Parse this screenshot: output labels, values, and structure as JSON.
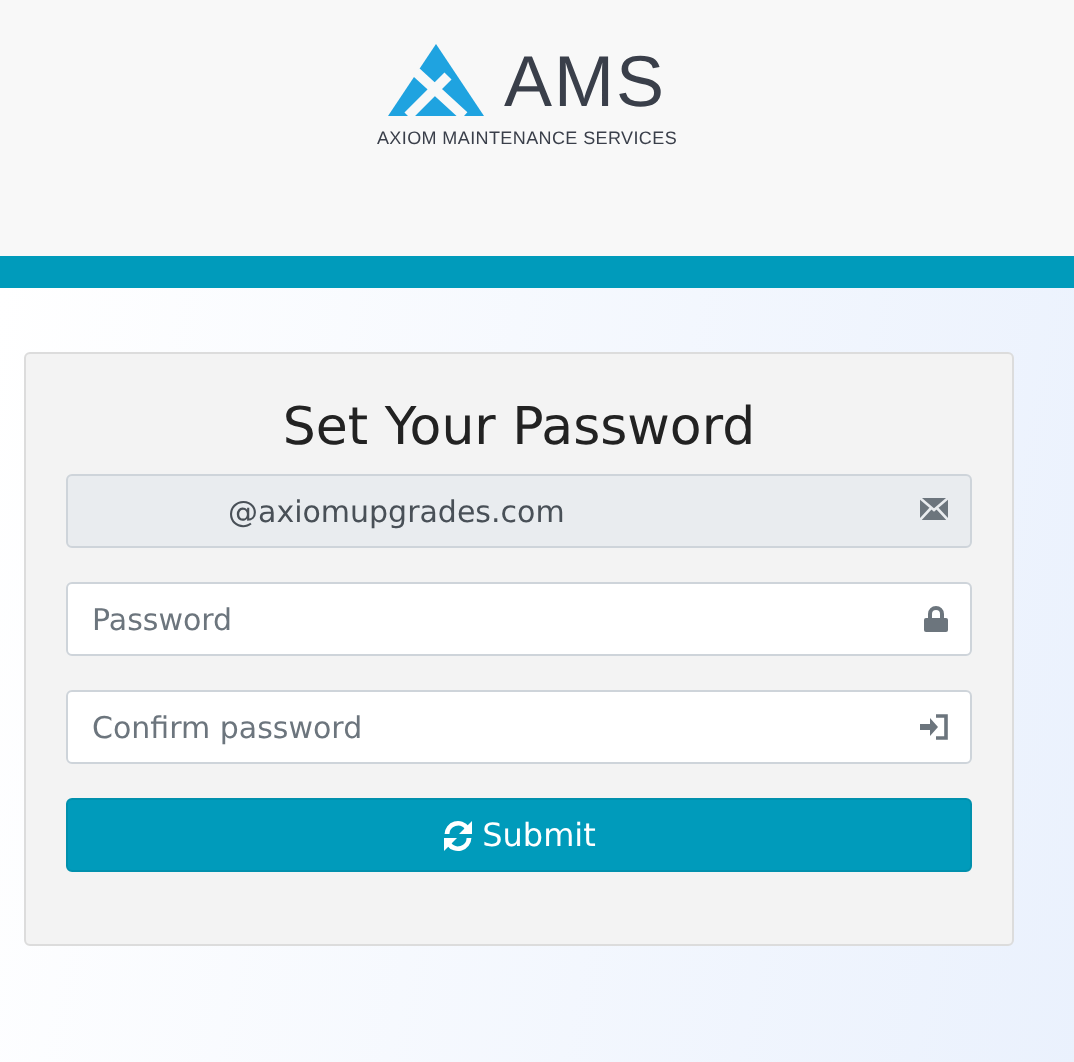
{
  "logo": {
    "name": "AMS",
    "tagline": "AXIOM MAINTENANCE SERVICES"
  },
  "form": {
    "title": "Set Your Password",
    "fields": [
      {
        "kind": "email",
        "value": "@axiomupgrades.com",
        "disabled": true
      },
      {
        "kind": "password",
        "placeholder": "Password",
        "disabled": false
      },
      {
        "kind": "confirm",
        "placeholder": "Confirm password",
        "disabled": false
      }
    ],
    "submit": "Submit"
  }
}
